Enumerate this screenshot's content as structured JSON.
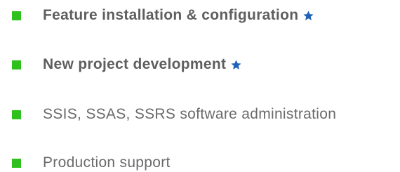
{
  "colors": {
    "bullet": "#2ec11e",
    "bold_text": "#5e5e5e",
    "light_text": "#6a6a6a",
    "star_fill": "#1e63b8",
    "star_outline": "#1e63b8"
  },
  "items": [
    {
      "label": "Feature installation & configuration",
      "emphasis": "bold",
      "bullet_icon": "green-square",
      "badge_icon": "star-icon"
    },
    {
      "label": "New project development",
      "emphasis": "bold",
      "bullet_icon": "green-square",
      "badge_icon": "star-icon"
    },
    {
      "label": "SSIS, SSAS, SSRS software administration",
      "emphasis": "normal",
      "bullet_icon": "green-square"
    },
    {
      "label": "Production support",
      "emphasis": "normal",
      "bullet_icon": "green-square"
    }
  ]
}
